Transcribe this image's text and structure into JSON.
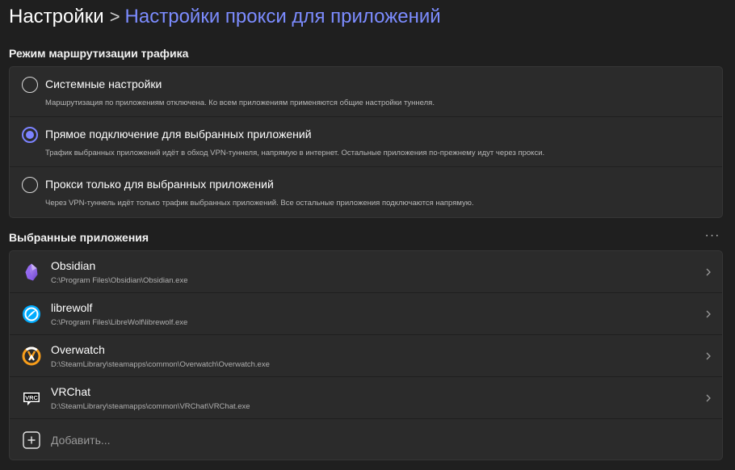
{
  "breadcrumb": {
    "root": "Настройки",
    "separator": ">",
    "current": "Настройки прокси для приложений"
  },
  "routing": {
    "title": "Режим маршрутизации трафика",
    "options": [
      {
        "label": "Системные настройки",
        "description": "Маршрутизация по приложениям отключена. Ко всем приложениям применяются общие настройки туннеля.",
        "selected": false
      },
      {
        "label": "Прямое подключение для выбранных приложений",
        "description": "Трафик выбранных приложений идёт в обход VPN-туннеля, напрямую в интернет. Остальные приложения по-прежнему идут через прокси.",
        "selected": true
      },
      {
        "label": "Прокси только для выбранных приложений",
        "description": "Через VPN-туннель идёт только трафик выбранных приложений. Все остальные приложения подключаются напрямую.",
        "selected": false
      }
    ]
  },
  "apps": {
    "title": "Выбранные приложения",
    "more_label": "···",
    "items": [
      {
        "name": "Obsidian",
        "path": "C:\\Program Files\\Obsidian\\Obsidian.exe",
        "icon": "obsidian-icon"
      },
      {
        "name": "librewolf",
        "path": "C:\\Program Files\\LibreWolf\\librewolf.exe",
        "icon": "librewolf-icon"
      },
      {
        "name": "Overwatch",
        "path": "D:\\SteamLibrary\\steamapps\\common\\Overwatch\\Overwatch.exe",
        "icon": "overwatch-icon"
      },
      {
        "name": "VRChat",
        "path": "D:\\SteamLibrary\\steamapps\\common\\VRChat\\VRChat.exe",
        "icon": "vrchat-icon"
      }
    ],
    "add_label": "Добавить..."
  },
  "colors": {
    "accent": "#7c83ff",
    "breadcrumb_current": "#7c8cff",
    "background": "#1f1f1f",
    "card": "#2b2b2b"
  }
}
